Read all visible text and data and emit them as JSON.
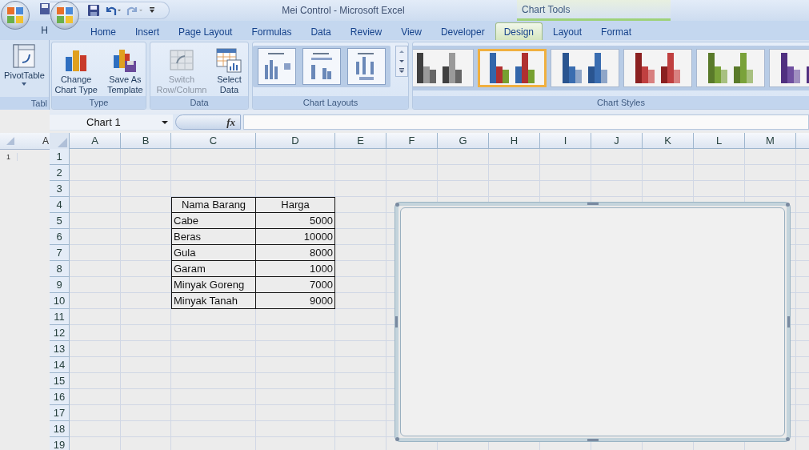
{
  "back_window": {
    "tab": "H",
    "group": {
      "button": "PivotTable",
      "label": "Tabl"
    },
    "column_header": "A",
    "row_header": "1"
  },
  "window": {
    "title": "Mei Control - Microsoft Excel",
    "contextual_tab_group": "Chart Tools"
  },
  "quick_access": [
    {
      "kind": "save",
      "disabled": false
    },
    {
      "kind": "undo",
      "disabled": false
    },
    {
      "kind": "redo",
      "disabled": true
    },
    {
      "kind": "customize",
      "disabled": false
    }
  ],
  "tabs": [
    {
      "label": "Home",
      "selected": false
    },
    {
      "label": "Insert",
      "selected": false
    },
    {
      "label": "Page Layout",
      "selected": false
    },
    {
      "label": "Formulas",
      "selected": false
    },
    {
      "label": "Data",
      "selected": false
    },
    {
      "label": "Review",
      "selected": false
    },
    {
      "label": "View",
      "selected": false
    },
    {
      "label": "Developer",
      "selected": false
    },
    {
      "label": "Design",
      "selected": true
    },
    {
      "label": "Layout",
      "selected": false
    },
    {
      "label": "Format",
      "selected": false
    }
  ],
  "ribbon": {
    "groups": [
      {
        "label": "Type",
        "kind": "buttons",
        "buttons": [
          {
            "kind": "change-chart-type",
            "lines": [
              "Change",
              "Chart Type"
            ],
            "disabled": false
          },
          {
            "kind": "save-as-template",
            "lines": [
              "Save As",
              "Template"
            ],
            "disabled": false
          }
        ]
      },
      {
        "label": "Data",
        "kind": "buttons",
        "buttons": [
          {
            "kind": "switch-row-column",
            "lines": [
              "Switch",
              "Row/Column"
            ],
            "disabled": true
          },
          {
            "kind": "select-data",
            "lines": [
              "Select",
              "Data"
            ],
            "disabled": false
          }
        ]
      },
      {
        "label": "Chart Layouts",
        "kind": "layout-gallery",
        "items": [
          {
            "kind": "legend-right"
          },
          {
            "kind": "labels-top"
          },
          {
            "kind": "legend-bottom"
          }
        ]
      },
      {
        "label": "Chart Styles",
        "kind": "style-gallery",
        "items": [
          {
            "selected": false,
            "series": [
              {
                "color": "#404040"
              },
              {
                "color": "#9a9a9a"
              },
              {
                "color": "#666666"
              }
            ]
          },
          {
            "selected": true,
            "series": [
              {
                "color": "#3366aa"
              },
              {
                "color": "#b03030"
              },
              {
                "color": "#77a030"
              }
            ]
          },
          {
            "selected": false,
            "series": [
              {
                "color": "#2a5590"
              },
              {
                "color": "#3a6db0"
              },
              {
                "color": "#8fa6c8"
              }
            ]
          },
          {
            "selected": false,
            "series": [
              {
                "color": "#8b2020"
              },
              {
                "color": "#c04040"
              },
              {
                "color": "#d88080"
              }
            ]
          },
          {
            "selected": false,
            "series": [
              {
                "color": "#5a7a2a"
              },
              {
                "color": "#7aa23a"
              },
              {
                "color": "#a8c080"
              }
            ]
          },
          {
            "selected": false,
            "series": [
              {
                "color": "#503080"
              },
              {
                "color": "#7050a0"
              },
              {
                "color": "#a090c0"
              }
            ]
          }
        ]
      }
    ]
  },
  "formula_bar": {
    "name_box": "Chart 1",
    "function_label": "fx"
  },
  "sheet": {
    "columns": [
      "A",
      "B",
      "C",
      "D",
      "E",
      "F",
      "G",
      "H",
      "I",
      "J",
      "K",
      "L",
      "M"
    ],
    "rows": [
      {
        "number": "1"
      },
      {
        "number": "2"
      },
      {
        "number": "3"
      },
      {
        "number": "4",
        "kind": "header",
        "column_c": "Nama Barang",
        "column_d": "Harga"
      },
      {
        "number": "5",
        "kind": "data",
        "column_c": "Cabe",
        "column_d": "5000"
      },
      {
        "number": "6",
        "kind": "data",
        "column_c": "Beras",
        "column_d": "10000"
      },
      {
        "number": "7",
        "kind": "data",
        "column_c": "Gula",
        "column_d": "8000"
      },
      {
        "number": "8",
        "kind": "data",
        "column_c": "Garam",
        "column_d": "1000"
      },
      {
        "number": "9",
        "kind": "data",
        "column_c": "Minyak Goreng",
        "column_d": "7000"
      },
      {
        "number": "10",
        "kind": "data",
        "column_c": "Minyak Tanah",
        "column_d": "9000"
      },
      {
        "number": "11"
      },
      {
        "number": "12"
      },
      {
        "number": "13"
      },
      {
        "number": "14"
      },
      {
        "number": "15"
      },
      {
        "number": "16"
      },
      {
        "number": "17"
      },
      {
        "number": "18"
      },
      {
        "number": "19"
      }
    ]
  },
  "chart": {
    "selected": true
  }
}
